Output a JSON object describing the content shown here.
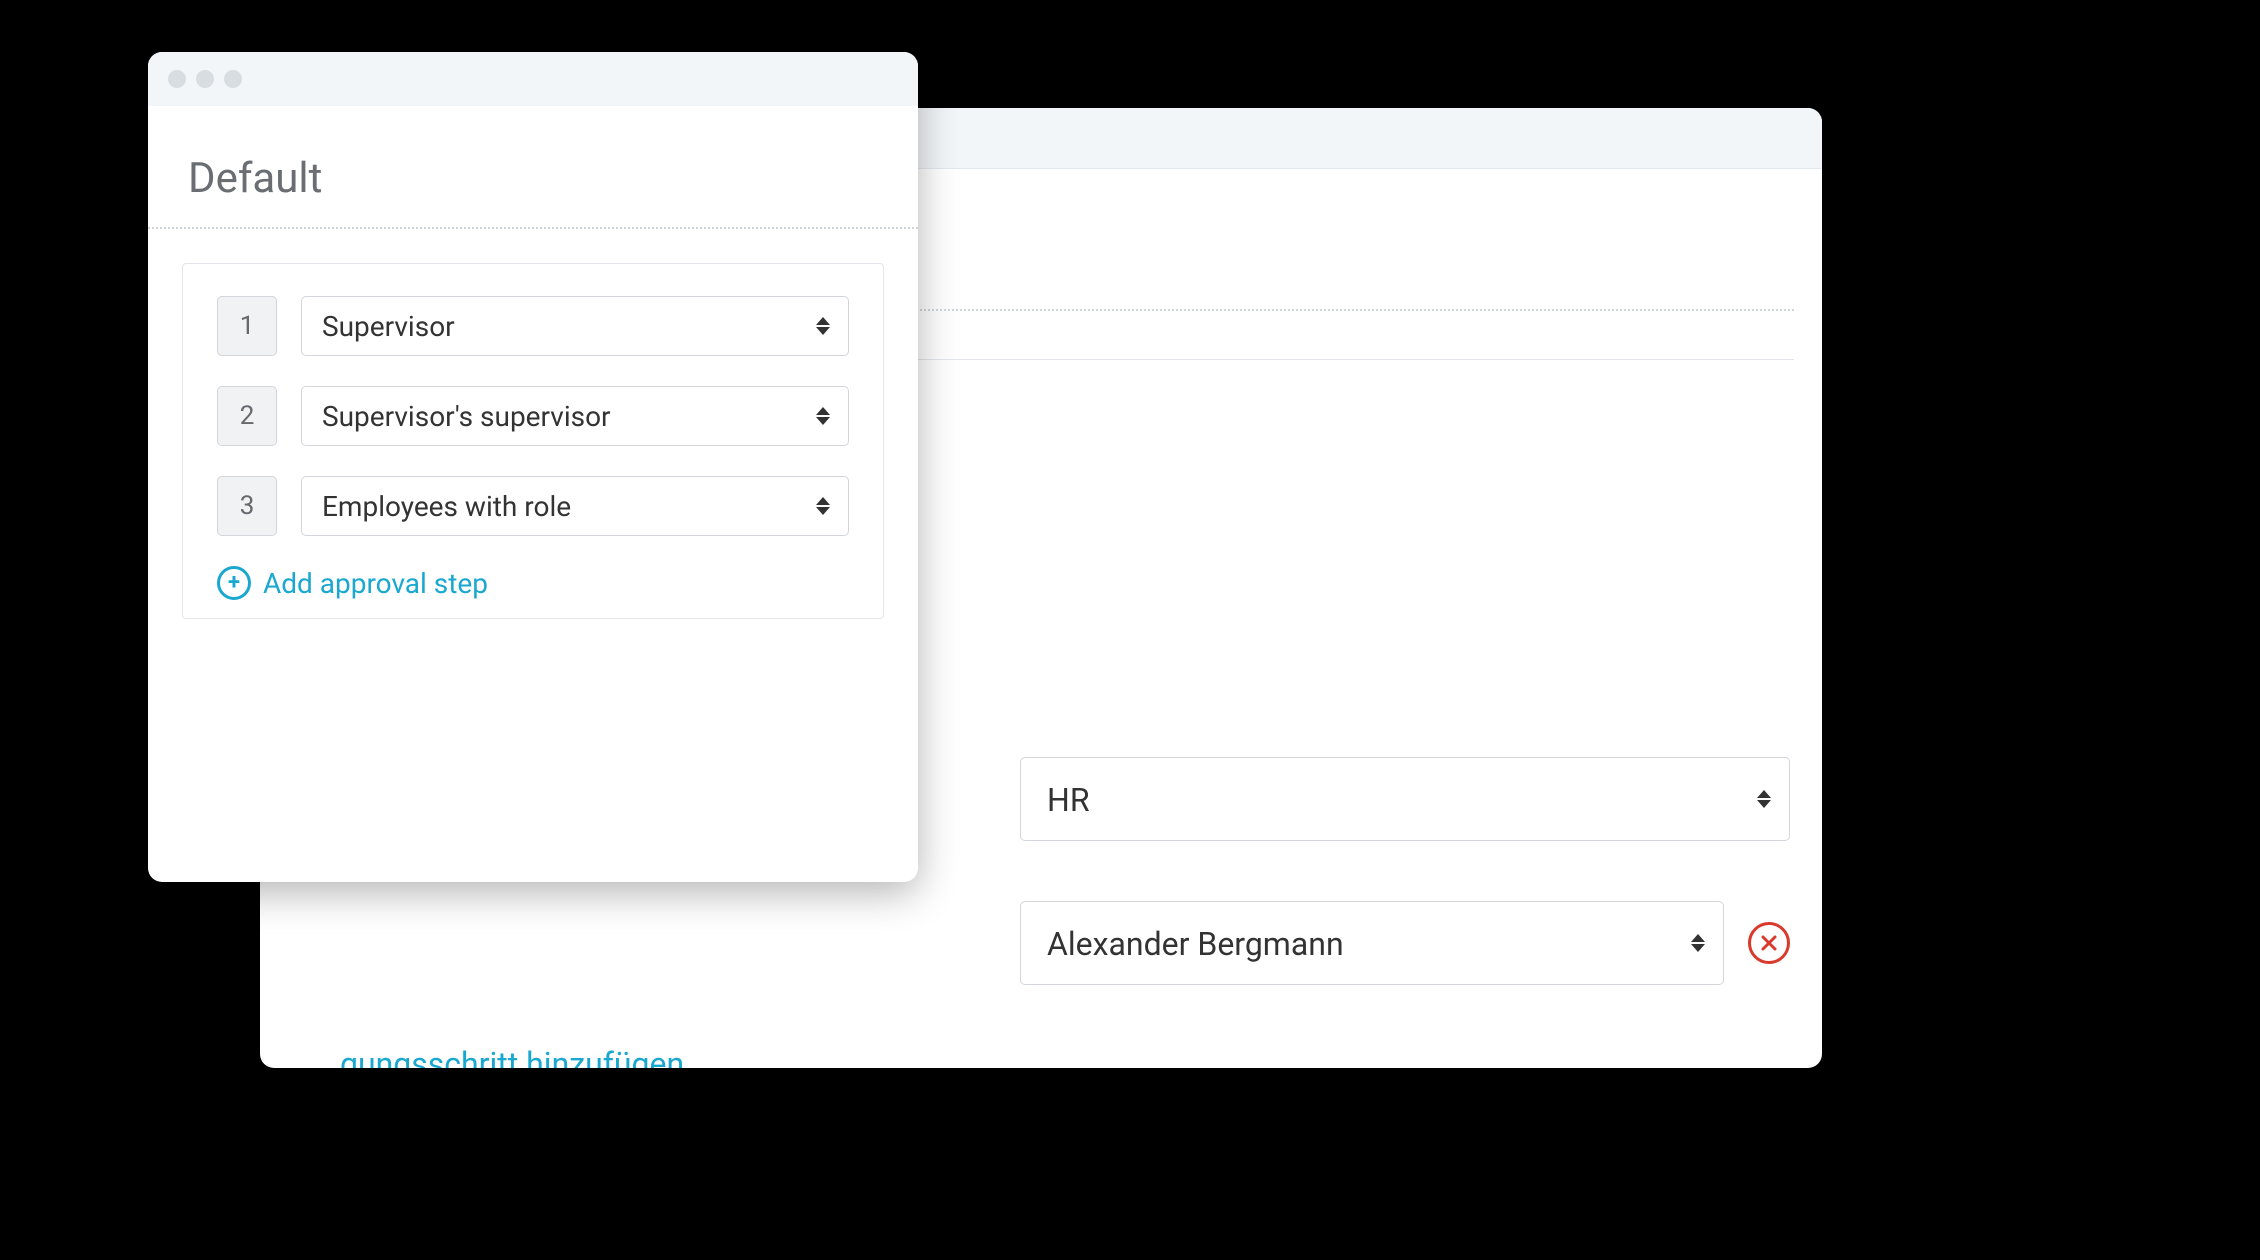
{
  "front_window": {
    "heading": "Default",
    "steps": [
      {
        "index": "1",
        "value": "Supervisor"
      },
      {
        "index": "2",
        "value": "Supervisor's supervisor"
      },
      {
        "index": "3",
        "value": "Employees with role"
      }
    ],
    "add_step_label": "Add approval step"
  },
  "back_window": {
    "role_select_value": "HR",
    "employee_select_value": "Alexander Bergmann",
    "add_step_label_partial": "gungsschritt hinzufügen"
  }
}
